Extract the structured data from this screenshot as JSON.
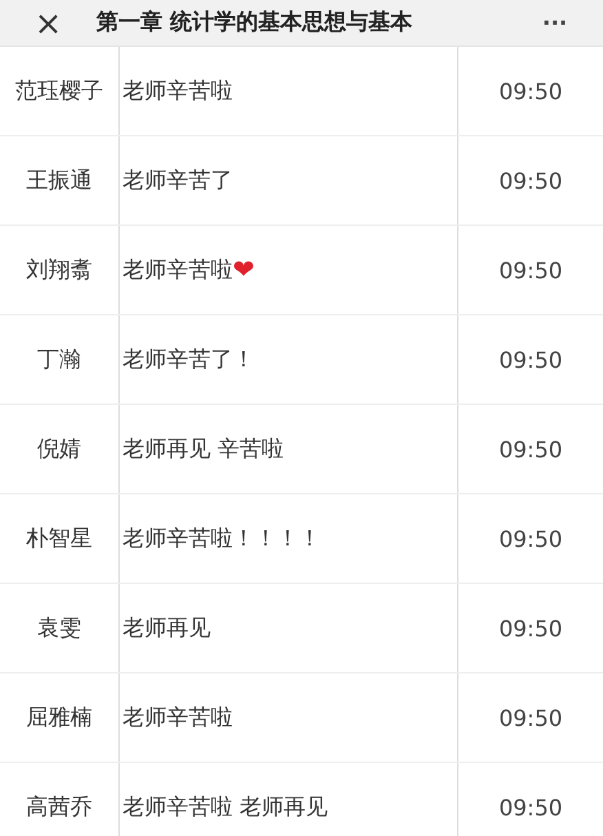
{
  "header": {
    "close": "×",
    "title": "第一章 统计学的基本思想与基本",
    "more": "···"
  },
  "rows": [
    {
      "name": "范珏樱子",
      "message": "老师辛苦啦",
      "time": "09:50"
    },
    {
      "name": "王振通",
      "message": "老师辛苦了",
      "time": "09:50"
    },
    {
      "name": "刘翔翥",
      "message": "老师辛苦啦",
      "emoji": "❤",
      "time": "09:50"
    },
    {
      "name": "丁瀚",
      "message": "老师辛苦了！",
      "time": "09:50"
    },
    {
      "name": "倪婧",
      "message": "老师再见 辛苦啦",
      "time": "09:50"
    },
    {
      "name": "朴智星",
      "message": "老师辛苦啦！！！！",
      "time": "09:50"
    },
    {
      "name": "袁雯",
      "message": "老师再见",
      "time": "09:50"
    },
    {
      "name": "屈雅楠",
      "message": "老师辛苦啦",
      "time": "09:50"
    },
    {
      "name": "高茜乔",
      "message": "老师辛苦啦 老师再见",
      "time": "09:50"
    }
  ]
}
